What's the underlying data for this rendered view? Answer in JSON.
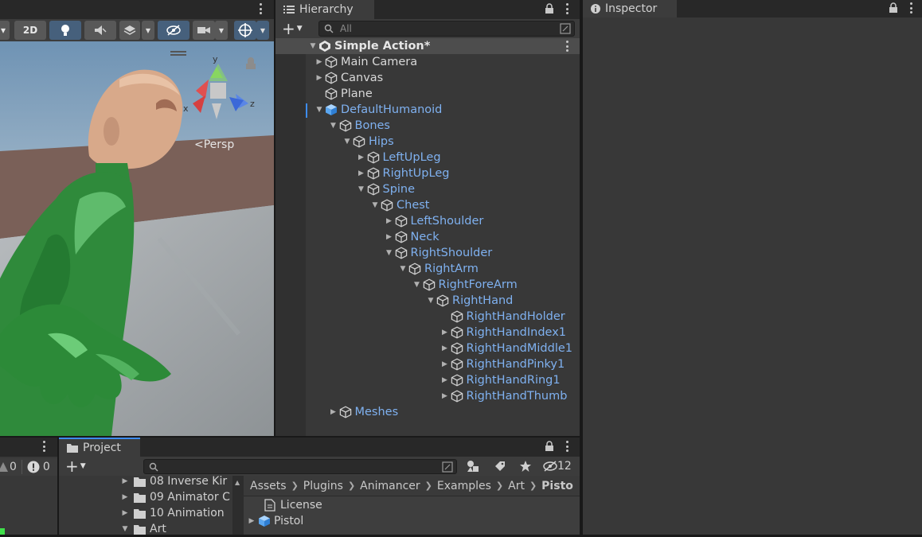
{
  "scene": {
    "toolbar": {
      "btn_2d": "2D",
      "persp_label": "Persp",
      "axis_x": "x",
      "axis_y": "y",
      "axis_z": "z"
    }
  },
  "hierarchy": {
    "tab_label": "Hierarchy",
    "search_placeholder": "All",
    "rows": [
      {
        "label": "Simple Action*",
        "depth": 0,
        "arrow": "down",
        "color": "white",
        "kind": "scene"
      },
      {
        "label": "Main Camera",
        "depth": 1,
        "arrow": "right",
        "color": "white"
      },
      {
        "label": "Canvas",
        "depth": 1,
        "arrow": "right",
        "color": "white"
      },
      {
        "label": "Plane",
        "depth": 1,
        "arrow": "none",
        "color": "white"
      },
      {
        "label": "DefaultHumanoid",
        "depth": 1,
        "arrow": "down",
        "color": "blue",
        "kind": "prefab"
      },
      {
        "label": "Bones",
        "depth": 2,
        "arrow": "down",
        "color": "blue"
      },
      {
        "label": "Hips",
        "depth": 3,
        "arrow": "down",
        "color": "blue"
      },
      {
        "label": "LeftUpLeg",
        "depth": 4,
        "arrow": "right",
        "color": "blue"
      },
      {
        "label": "RightUpLeg",
        "depth": 4,
        "arrow": "right",
        "color": "blue"
      },
      {
        "label": "Spine",
        "depth": 4,
        "arrow": "down",
        "color": "blue"
      },
      {
        "label": "Chest",
        "depth": 5,
        "arrow": "down",
        "color": "blue"
      },
      {
        "label": "LeftShoulder",
        "depth": 6,
        "arrow": "right",
        "color": "blue"
      },
      {
        "label": "Neck",
        "depth": 6,
        "arrow": "right",
        "color": "blue"
      },
      {
        "label": "RightShoulder",
        "depth": 6,
        "arrow": "down",
        "color": "blue"
      },
      {
        "label": "RightArm",
        "depth": 7,
        "arrow": "down",
        "color": "blue"
      },
      {
        "label": "RightForeArm",
        "depth": 8,
        "arrow": "down",
        "color": "blue"
      },
      {
        "label": "RightHand",
        "depth": 9,
        "arrow": "down",
        "color": "blue"
      },
      {
        "label": "RightHandHolder",
        "depth": 10,
        "arrow": "none",
        "color": "blue"
      },
      {
        "label": "RightHandIndex1",
        "depth": 10,
        "arrow": "right",
        "color": "blue"
      },
      {
        "label": "RightHandMiddle1",
        "depth": 10,
        "arrow": "right",
        "color": "blue"
      },
      {
        "label": "RightHandPinky1",
        "depth": 10,
        "arrow": "right",
        "color": "blue"
      },
      {
        "label": "RightHandRing1",
        "depth": 10,
        "arrow": "right",
        "color": "blue"
      },
      {
        "label": "RightHandThumb",
        "depth": 10,
        "arrow": "right",
        "color": "blue"
      },
      {
        "label": "Meshes",
        "depth": 2,
        "arrow": "right",
        "color": "blue"
      }
    ]
  },
  "inspector": {
    "tab_label": "Inspector"
  },
  "console": {
    "warn_count": "0",
    "error_count": "0"
  },
  "project": {
    "tab_label": "Project",
    "hidden_count": "12",
    "folders": [
      {
        "label": "08 Inverse Kir",
        "arrow": "right"
      },
      {
        "label": "09 Animator C",
        "arrow": "right"
      },
      {
        "label": "10 Animation",
        "arrow": "right"
      },
      {
        "label": "Art",
        "arrow": "down"
      }
    ],
    "breadcrumb": [
      "Assets",
      "Plugins",
      "Animancer",
      "Examples",
      "Art",
      "Pisto"
    ],
    "files": [
      {
        "label": "License",
        "arrow": "none",
        "icon": "document-icon"
      },
      {
        "label": "Pistol",
        "arrow": "right",
        "icon": "prefab-icon"
      }
    ]
  }
}
